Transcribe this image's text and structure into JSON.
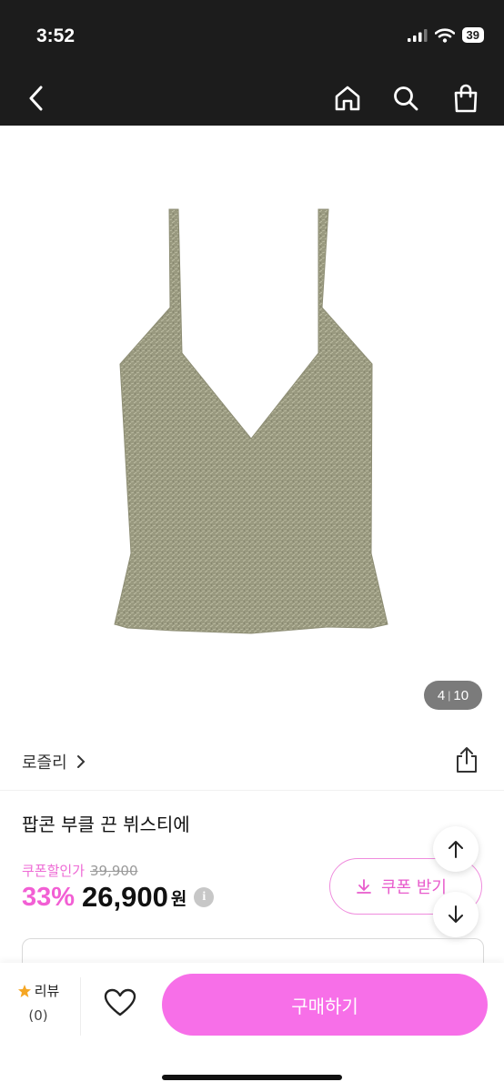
{
  "status": {
    "time": "3:52",
    "battery": "39"
  },
  "nav": {
    "icons": [
      "back-icon",
      "home-icon",
      "search-icon",
      "shopping-bag-icon"
    ]
  },
  "gallery": {
    "current": "4",
    "total": "10"
  },
  "product": {
    "brand": "로즐리",
    "title": "팝콘 부클 끈 뷔스티에",
    "coupon_label": "쿠폰할인가",
    "original_price": "39,900",
    "discount": "33%",
    "price": "26,900",
    "currency": "원",
    "coupon_button": "쿠폰 받기"
  },
  "bottom": {
    "review_label": "리뷰",
    "review_count": "(0)",
    "buy_label": "구매하기"
  },
  "colors": {
    "accent": "#f76fe8",
    "discount": "#f25fd4",
    "garment": "#9a9a82",
    "statusbar": "#1c1c1c"
  }
}
